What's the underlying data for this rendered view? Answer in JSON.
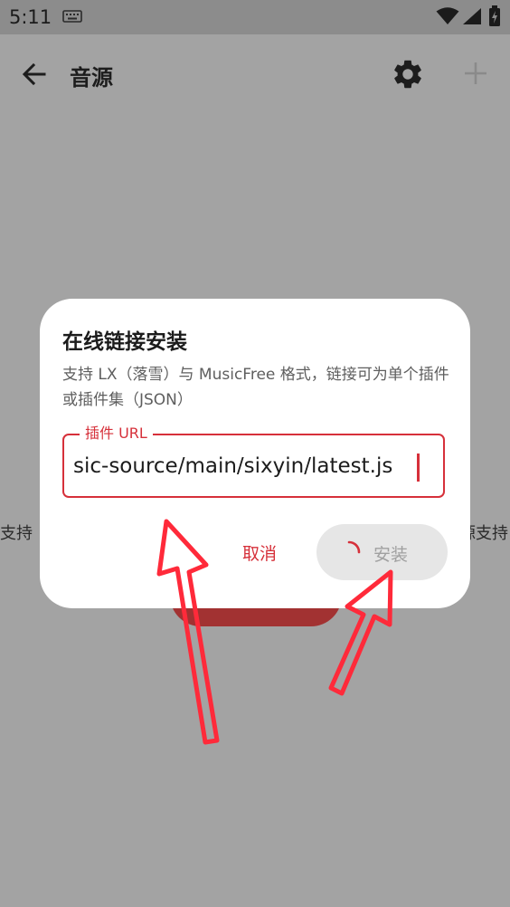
{
  "status_bar": {
    "time": "5:11",
    "icons": [
      "keyboard-icon",
      "wifi-icon",
      "signal-icon",
      "battery-icon"
    ]
  },
  "app_bar": {
    "title": "音源",
    "back_icon": "back-arrow-icon",
    "actions": [
      "gear-icon",
      "plus-icon"
    ]
  },
  "background": {
    "left_text": "支持",
    "right_text": "源支持"
  },
  "dialog": {
    "title": "在线链接安装",
    "description": "支持 LX（落雪）与 MusicFree 格式，链接可为单个插件或插件集（JSON）",
    "url_field": {
      "label": "插件 URL",
      "value": "sic-source/main/sixyin/latest.js"
    },
    "cancel_label": "取消",
    "install_label": "安装",
    "install_loading": true
  },
  "colors": {
    "accent": "#d6303a",
    "scrim": "#a3a3a3",
    "annotation_arrow": "#ff2a3a"
  }
}
